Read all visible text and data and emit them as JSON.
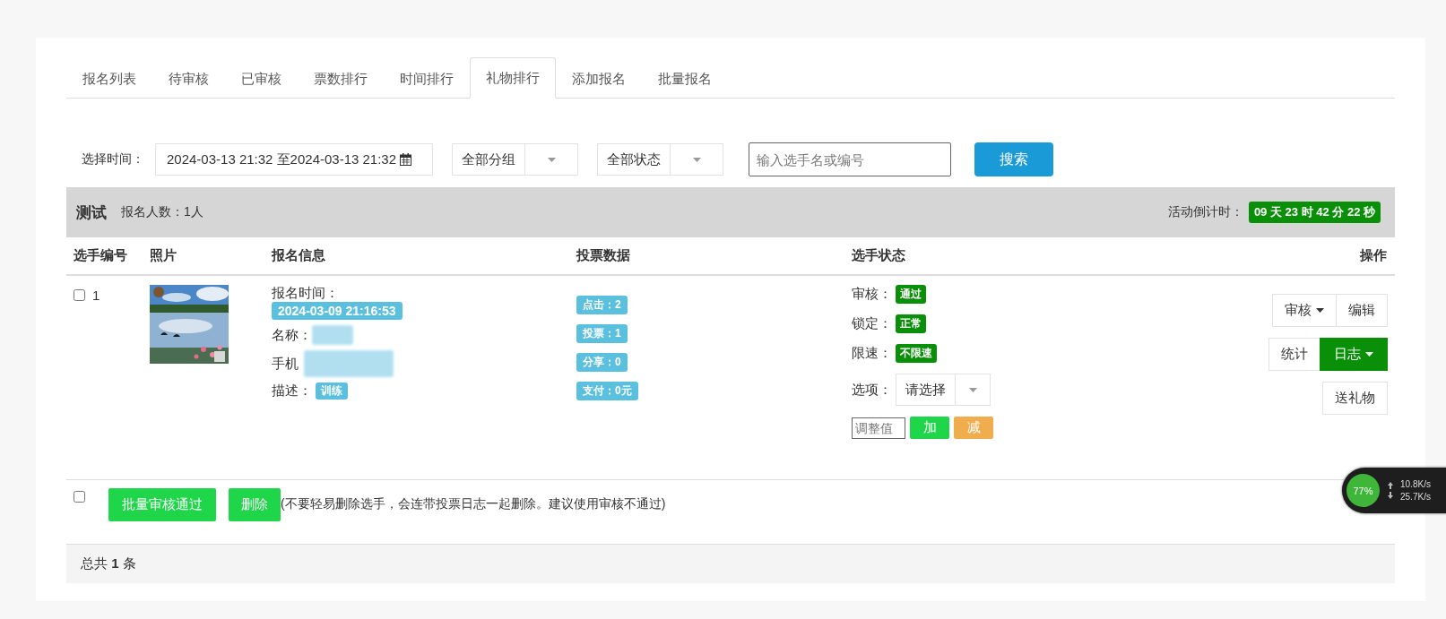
{
  "tabs": [
    {
      "label": "报名列表",
      "selected": false
    },
    {
      "label": "待审核",
      "selected": false
    },
    {
      "label": "已审核",
      "selected": false
    },
    {
      "label": "票数排行",
      "selected": false
    },
    {
      "label": "时间排行",
      "selected": false
    },
    {
      "label": "礼物排行",
      "selected": true
    },
    {
      "label": "添加报名",
      "selected": false
    },
    {
      "label": "批量报名",
      "selected": false
    }
  ],
  "filters": {
    "time_label": "选择时间：",
    "time_range": "2024-03-13 21:32 至2024-03-13 21:32",
    "group_select": "全部分组",
    "status_select": "全部状态",
    "search_placeholder": "输入选手名或编号",
    "search_button": "搜索"
  },
  "activity": {
    "title": "测试",
    "signup_count": "报名人数：1人",
    "countdown_label": "活动倒计时：",
    "countdown": "09 天 23 时 42 分 22 秒"
  },
  "table": {
    "columns": [
      "选手编号",
      "照片",
      "报名信息",
      "投票数据",
      "选手状态",
      "操作"
    ],
    "rows": [
      {
        "checked": false,
        "number": "1",
        "photo": {
          "kind": "picture"
        },
        "signup_time_label": "报名时间：",
        "signup_time": "2024-03-09 21:16:53",
        "name_label": "名称：",
        "phone_label": "手机",
        "desc_label": "描述：",
        "desc_tag": "训练",
        "stats": [
          "点击：2",
          "投票：1",
          "分享：0",
          "支付：0元"
        ],
        "status": [
          {
            "label": "审核：",
            "value": "通过"
          },
          {
            "label": "锁定：",
            "value": "正常"
          },
          {
            "label": "限速：",
            "value": "不限速"
          }
        ],
        "option_label": "选项：",
        "option_select": "请选择",
        "adjust_placeholder": "调整值",
        "add_button": "加",
        "subtract_button": "减",
        "actions": [
          {
            "label": "审核",
            "kind": "dropdown",
            "primary": false
          },
          {
            "label": "编辑",
            "kind": "button",
            "primary": false
          },
          {
            "label": "统计",
            "kind": "button",
            "primary": false
          },
          {
            "label": "日志",
            "kind": "dropdown",
            "primary": true
          },
          {
            "label": "送礼物",
            "kind": "button",
            "primary": false
          }
        ]
      }
    ]
  },
  "bulk": {
    "checked": false,
    "approve_button": "批量审核通过",
    "delete_button": "删除",
    "note": "(不要轻易删除选手，会连带投票日志一起删除。建议使用审核不通过)"
  },
  "footer": {
    "total": "总共 **1** 条"
  },
  "speed_widget": {
    "percent": "77%",
    "upload": "10.8K/s",
    "download": "25.7K/s"
  }
}
